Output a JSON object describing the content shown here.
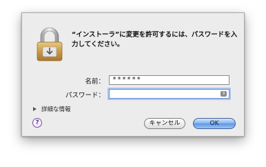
{
  "dialog": {
    "message": "“インストーラ”に変更を許可するには、パスワードを入力してください。",
    "fields": {
      "name_label": "名前：",
      "name_value": "******",
      "password_label": "パスワード：",
      "password_value": ""
    },
    "details_label": "詳細な情報",
    "help_label": "?",
    "buttons": {
      "cancel": "キャンセル",
      "ok": "OK"
    },
    "icons": {
      "lock": "lock-icon",
      "keychain": "keychain-icon",
      "disclosure": "disclosure-triangle-icon",
      "help": "help-icon"
    },
    "colors": {
      "window_bg": "#ececec",
      "default_button": "#6fa3e8",
      "focus_ring": "#a9c6f2"
    }
  }
}
